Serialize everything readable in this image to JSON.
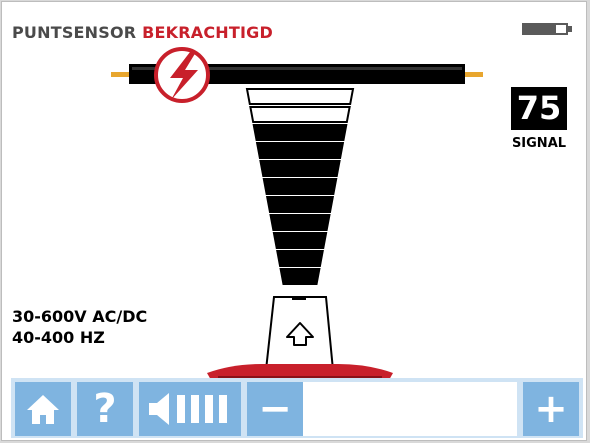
{
  "header": {
    "title_prefix": "PUNTSENSOR",
    "title_status": "BEKRACHTIGD",
    "status_color": "#c8202b"
  },
  "signal": {
    "value": "75",
    "label": "SIGNAL",
    "level_percent": 75
  },
  "specs": {
    "voltage": "30-600V AC/DC",
    "frequency": "40-400 HZ"
  },
  "toolbar": {
    "help_glyph": "?",
    "minus_glyph": "−",
    "plus_glyph": "+",
    "buttons": [
      "home-icon",
      "help-icon",
      "volume-icon",
      "minus-icon",
      "plus-icon"
    ],
    "accent": "#7fb4e0"
  },
  "icons": {
    "voltage_warning": "lightning-icon",
    "battery": "battery-icon",
    "probe_up": "arrow-up-icon"
  }
}
